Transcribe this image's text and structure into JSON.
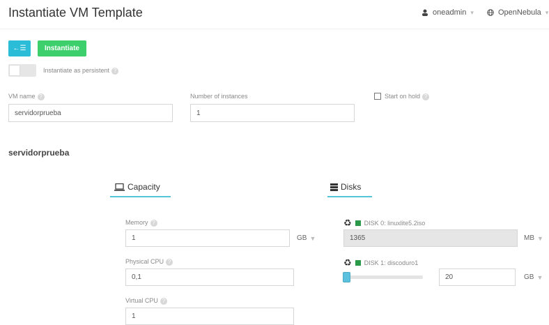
{
  "header": {
    "title": "Instantiate VM Template",
    "user": "oneadmin",
    "zone": "OpenNebula"
  },
  "toolbar": {
    "back_label": "←☰",
    "instantiate_label": "Instantiate"
  },
  "persistent": {
    "label": "Instantiate as persistent",
    "on": false
  },
  "form": {
    "vm_name_label": "VM name",
    "vm_name_value": "servidorprueba",
    "instances_label": "Number of instances",
    "instances_value": "1",
    "hold_label": "Start on hold"
  },
  "section_title": "servidorprueba",
  "tabs": [
    {
      "label": "Capacity",
      "icon": "laptop-icon"
    },
    {
      "label": "Disks",
      "icon": "disks-icon"
    }
  ],
  "capacity": {
    "memory_label": "Memory",
    "memory_value": "1",
    "memory_unit": "GB",
    "physical_cpu_label": "Physical CPU",
    "physical_cpu_value": "0,1",
    "virtual_cpu_label": "Virtual CPU",
    "virtual_cpu_value": "1"
  },
  "disks": [
    {
      "label": "DISK 0: linuxlite5.2iso",
      "value": "1365",
      "unit": "MB"
    },
    {
      "label": "DISK 1: discoduro1",
      "value": "20",
      "unit": "GB",
      "slider_fraction": 0.0
    }
  ],
  "colors": {
    "back_button": "#2bbcd7",
    "instantiate_button": "#3ccf6b",
    "tab_underline": "#55c5d9",
    "disk_marker": "#2a9a4a"
  }
}
